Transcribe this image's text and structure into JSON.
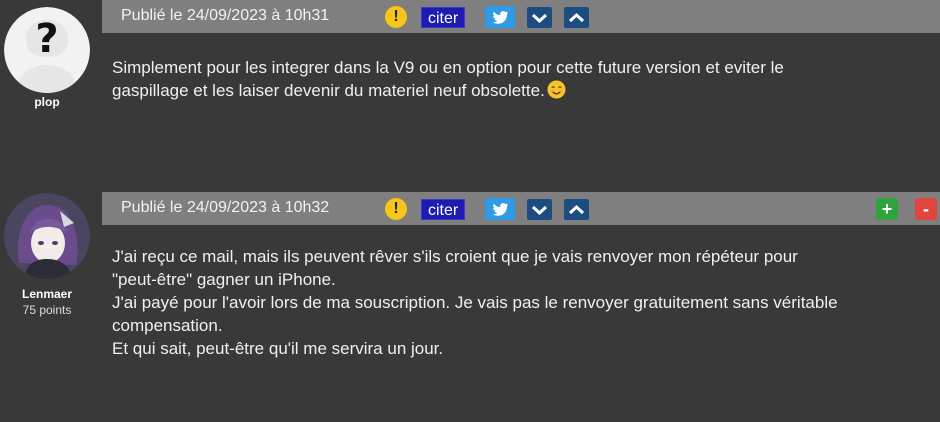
{
  "posts": [
    {
      "author": "plop",
      "points": "",
      "date": "Publié le 24/09/2023 à 10h31",
      "cite_label": "citer",
      "lines": [
        "Simplement pour les integrer dans la V9 ou en option pour cette future version  et eviter le",
        "gaspillage et les laiser devenir du materiel neuf obsolette."
      ],
      "warn_symbol": "!"
    },
    {
      "author": "Lenmaer",
      "points": "75 points",
      "date": "Publié le 24/09/2023 à 10h32",
      "cite_label": "citer",
      "lines": [
        "J'ai reçu ce mail, mais ils peuvent rêver s'ils croient que je vais renvoyer mon répéteur pour",
        "\"peut-être\" gagner un iPhone.",
        "J'ai payé pour l'avoir lors de ma souscription. Je vais pas le renvoyer gratuitement sans véritable",
        "compensation.",
        "Et qui sait, peut-être qu'il me servira un jour."
      ],
      "warn_symbol": "!",
      "plus_label": "+",
      "minus_label": "-"
    }
  ],
  "icons": [
    "warning-icon",
    "twitter-icon",
    "chevron-down-icon",
    "chevron-up-icon",
    "smile-emoji-icon"
  ],
  "colors": {
    "header": "#7f7f7f",
    "background": "#393939",
    "cite": "#1c1cb0",
    "twitter": "#2f9be6",
    "arrow": "#1c4d80",
    "plus": "#2ea33e",
    "minus": "#e0463b"
  }
}
